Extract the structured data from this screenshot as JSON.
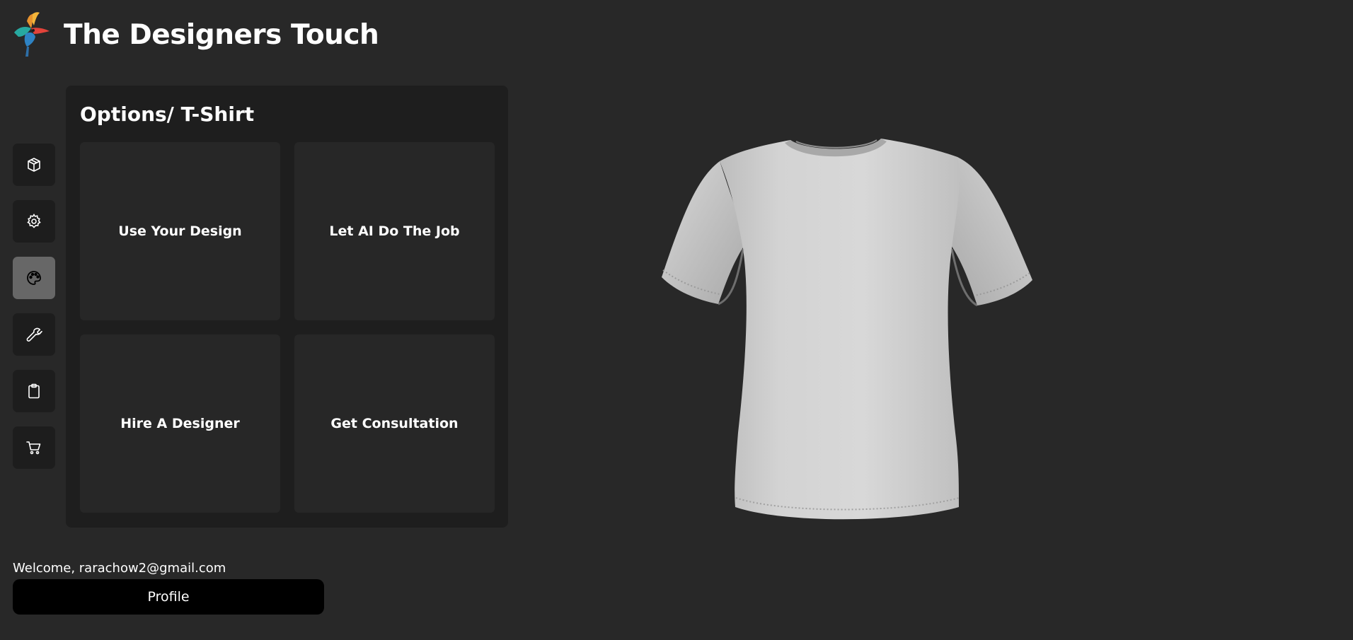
{
  "header": {
    "brand_title": "The Designers Touch",
    "logo_icon": "hummingbird-logo-icon"
  },
  "sidebar": {
    "items": [
      {
        "icon": "box-icon",
        "active": false
      },
      {
        "icon": "gear-icon",
        "active": false
      },
      {
        "icon": "palette-icon",
        "active": true
      },
      {
        "icon": "wrench-icon",
        "active": false
      },
      {
        "icon": "clipboard-icon",
        "active": false
      },
      {
        "icon": "cart-icon",
        "active": false
      }
    ]
  },
  "panel": {
    "title": "Options/ T-Shirt",
    "options": [
      {
        "label": "Use Your Design"
      },
      {
        "label": "Let AI Do The Job"
      },
      {
        "label": "Hire A Designer"
      },
      {
        "label": "Get Consultation"
      }
    ]
  },
  "viewer": {
    "product_icon": "tshirt-model"
  },
  "user": {
    "welcome_text": "Welcome, rarachow2@gmail.com",
    "profile_label": "Profile"
  },
  "colors": {
    "background": "#282828",
    "panel": "#1e1e1e",
    "card": "#272727",
    "active_tab": "#676767",
    "button": "#000000"
  }
}
